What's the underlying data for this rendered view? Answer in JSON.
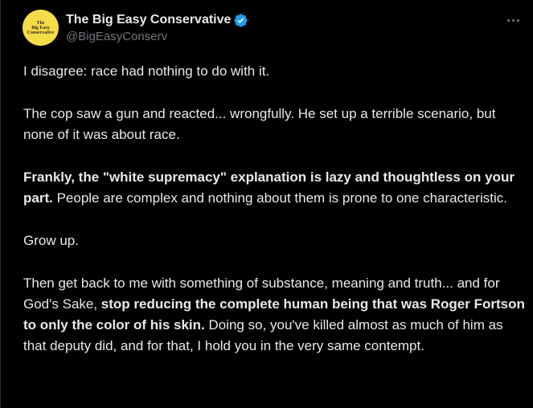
{
  "author": {
    "display_name": "The Big Easy Conservative",
    "handle": "@BigEasyConserv",
    "avatar_text": [
      "The",
      "Big Easy",
      "Conservative"
    ]
  },
  "icons": {
    "verified": "verified-badge-icon",
    "more": "more-options-icon"
  },
  "colors": {
    "background": "#000000",
    "text": "#e7e9ea",
    "secondary_text": "#71767b",
    "verified_blue": "#1d9bf0",
    "avatar_bg": "#f4dd48"
  },
  "tweet": {
    "p1": "I disagree: race had nothing to do with it.",
    "p2": "The cop saw a gun and reacted... wrongfully.  He set up a terrible scenario, but none of it was about race.",
    "p3_bold": "Frankly, the \"white supremacy\" explanation is lazy and thoughtless on your part.",
    "p3_rest": "  People are complex and nothing about them is prone to one characteristic.",
    "p4": "Grow up.",
    "p5_start": "Then get back to me with something of substance, meaning and truth... and for God's Sake, ",
    "p5_bold": "stop reducing the complete human being that was Roger Fortson to only the color of his skin.",
    "p5_end": "  Doing so, you've killed almost as much of him as that deputy did, and for that, I hold you in the very same contempt."
  }
}
